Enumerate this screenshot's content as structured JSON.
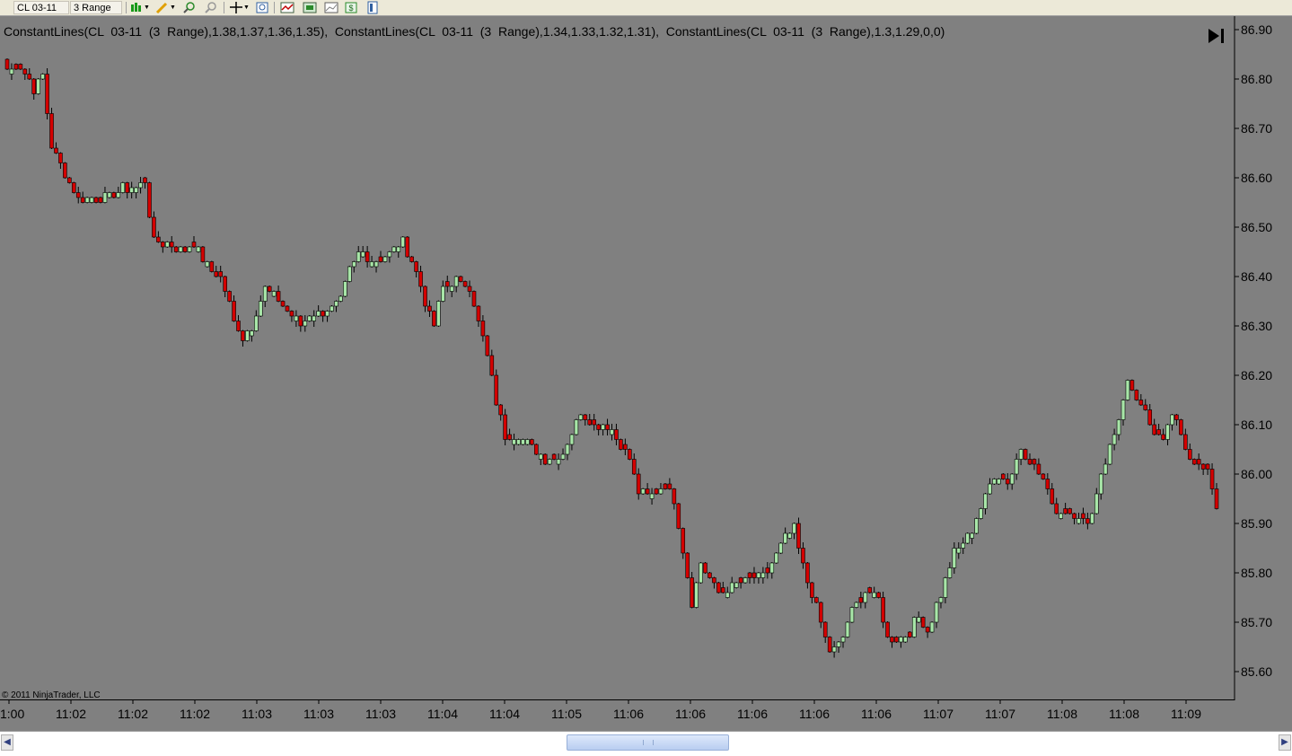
{
  "toolbar": {
    "instrument": "CL 03-11",
    "period": "3 Range",
    "icons": [
      "chart-style-icon",
      "draw-tool-icon",
      "zoom-in-icon",
      "zoom-out-icon",
      "crosshair-icon",
      "magnify-icon",
      "indicators-icon",
      "strategies-icon",
      "data-box-icon",
      "dollar-icon",
      "properties-icon"
    ]
  },
  "chart": {
    "indicator_label": "ConstantLines(CL  03-11  (3  Range),1.38,1.37,1.36,1.35),  ConstantLines(CL  03-11  (3  Range),1.34,1.33,1.32,1.31),  ConstantLines(CL  03-11  (3  Range),1.3,1.29,0,0)",
    "copyright": "© 2011 NinjaTrader, LLC",
    "colors": {
      "background": "#808080",
      "up": "#a8e6a8",
      "down": "#d40000",
      "outline": "#000000"
    }
  },
  "chart_data": {
    "type": "candlestick",
    "y_ticks": [
      "86.90",
      "86.80",
      "86.70",
      "86.60",
      "86.50",
      "86.40",
      "86.30",
      "86.20",
      "86.10",
      "86.00",
      "85.90",
      "85.80",
      "85.70",
      "85.60"
    ],
    "ylim": [
      85.57,
      86.92
    ],
    "x_ticks": [
      "1:00",
      "11:02",
      "11:02",
      "11:02",
      "11:03",
      "11:03",
      "11:03",
      "11:04",
      "11:04",
      "11:05",
      "11:06",
      "11:06",
      "11:06",
      "11:06",
      "11:06",
      "11:07",
      "11:07",
      "11:08",
      "11:08",
      "11:09"
    ],
    "close_path": [
      [
        0,
        86.82
      ],
      [
        3,
        86.83
      ],
      [
        6,
        86.78
      ],
      [
        8,
        86.81
      ],
      [
        10,
        86.66
      ],
      [
        13,
        86.61
      ],
      [
        16,
        86.56
      ],
      [
        22,
        86.56
      ],
      [
        26,
        86.58
      ],
      [
        29,
        86.58
      ],
      [
        31,
        86.59
      ],
      [
        33,
        86.47
      ],
      [
        35,
        86.47
      ],
      [
        39,
        86.45
      ],
      [
        42,
        86.47
      ],
      [
        45,
        86.42
      ],
      [
        48,
        86.4
      ],
      [
        51,
        86.31
      ],
      [
        53,
        86.28
      ],
      [
        55,
        86.3
      ],
      [
        58,
        86.38
      ],
      [
        60,
        86.36
      ],
      [
        63,
        86.33
      ],
      [
        66,
        86.3
      ],
      [
        69,
        86.33
      ],
      [
        72,
        86.33
      ],
      [
        75,
        86.35
      ],
      [
        77,
        86.41
      ],
      [
        79,
        86.45
      ],
      [
        83,
        86.43
      ],
      [
        86,
        86.45
      ],
      [
        89,
        86.47
      ],
      [
        92,
        86.41
      ],
      [
        94,
        86.35
      ],
      [
        96,
        86.3
      ],
      [
        98,
        86.38
      ],
      [
        101,
        86.39
      ],
      [
        104,
        86.38
      ],
      [
        106,
        86.31
      ],
      [
        108,
        86.24
      ],
      [
        110,
        86.15
      ],
      [
        112,
        86.08
      ],
      [
        115,
        86.08
      ],
      [
        118,
        86.05
      ],
      [
        121,
        86.03
      ],
      [
        125,
        86.04
      ],
      [
        129,
        86.13
      ],
      [
        132,
        86.1
      ],
      [
        135,
        86.1
      ],
      [
        138,
        86.06
      ],
      [
        140,
        86.03
      ],
      [
        142,
        85.96
      ],
      [
        145,
        85.96
      ],
      [
        148,
        85.98
      ],
      [
        150,
        85.95
      ],
      [
        152,
        85.85
      ],
      [
        154,
        85.74
      ],
      [
        156,
        85.82
      ],
      [
        160,
        85.76
      ],
      [
        165,
        85.78
      ],
      [
        170,
        85.79
      ],
      [
        175,
        85.87
      ],
      [
        177,
        85.89
      ],
      [
        179,
        85.81
      ],
      [
        181,
        85.76
      ],
      [
        183,
        85.7
      ],
      [
        185,
        85.64
      ],
      [
        187,
        85.65
      ],
      [
        190,
        85.72
      ],
      [
        193,
        85.76
      ],
      [
        196,
        85.75
      ],
      [
        198,
        85.67
      ],
      [
        202,
        85.67
      ],
      [
        205,
        85.71
      ],
      [
        207,
        85.68
      ],
      [
        210,
        85.76
      ],
      [
        213,
        85.84
      ],
      [
        216,
        85.87
      ],
      [
        219,
        85.93
      ],
      [
        222,
        86.0
      ],
      [
        225,
        85.98
      ],
      [
        228,
        86.05
      ],
      [
        231,
        86.02
      ],
      [
        233,
        85.99
      ],
      [
        236,
        85.92
      ],
      [
        239,
        85.93
      ],
      [
        242,
        85.9
      ],
      [
        244,
        85.92
      ],
      [
        246,
        86.0
      ],
      [
        249,
        86.08
      ],
      [
        252,
        86.18
      ],
      [
        254,
        86.15
      ],
      [
        256,
        86.12
      ],
      [
        258,
        86.09
      ],
      [
        260,
        86.08
      ],
      [
        262,
        86.12
      ],
      [
        264,
        86.08
      ],
      [
        266,
        86.03
      ],
      [
        270,
        86.0
      ],
      [
        272,
        85.93
      ]
    ]
  }
}
